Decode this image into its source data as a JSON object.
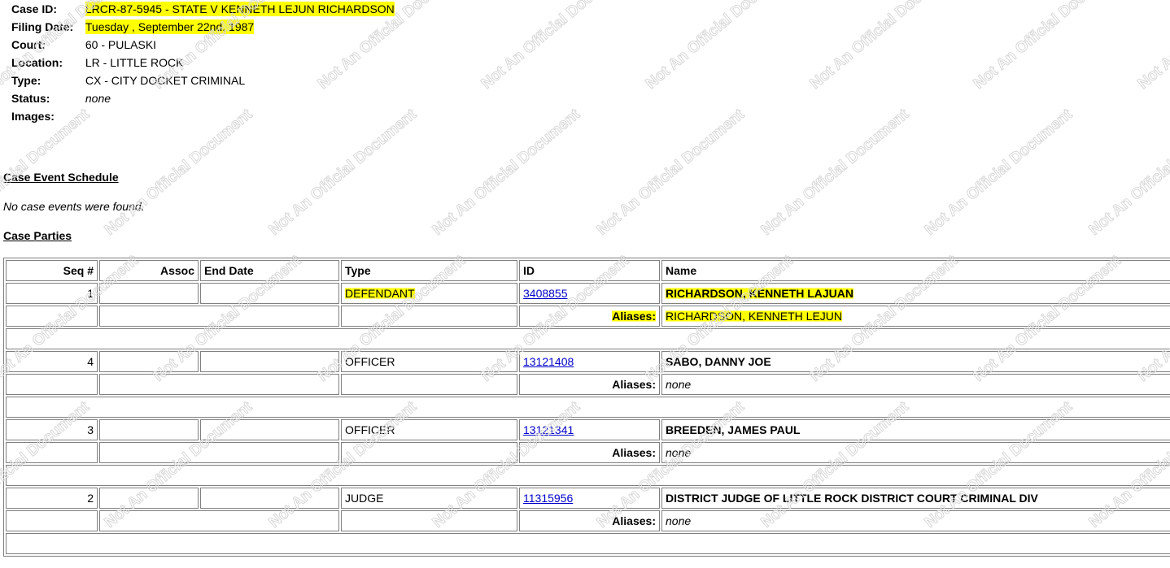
{
  "case": {
    "case_id_label": "Case ID:",
    "case_id_value": "LRCR-87-5945 - STATE V KENNETH LEJUN RICHARDSON",
    "filing_date_label": "Filing Date:",
    "filing_date_value": "Tuesday , September 22nd, 1987",
    "court_label": "Court:",
    "court_value": "60 - PULASKI",
    "location_label": "Location:",
    "location_value": "LR - LITTLE ROCK",
    "type_label": "Type:",
    "type_value": "CX - CITY DOCKET CRIMINAL",
    "status_label": "Status:",
    "status_value": "none",
    "images_label": "Images:"
  },
  "events": {
    "title": "Case Event Schedule",
    "empty_text": "No case events were found."
  },
  "parties": {
    "title": "Case Parties",
    "headers": {
      "seq": "Seq #",
      "assoc": "Assoc",
      "end_date": "End Date",
      "type": "Type",
      "id": "ID",
      "name": "Name"
    },
    "aliases_label": "Aliases:",
    "rows": [
      {
        "seq": "1",
        "assoc": "",
        "end_date": "",
        "type": "DEFENDANT",
        "id": "3408855",
        "name": "RICHARDSON, KENNETH LAJUAN",
        "aliases": "RICHARDSON, KENNETH LEJUN"
      },
      {
        "seq": "4",
        "assoc": "",
        "end_date": "",
        "type": "OFFICER",
        "id": "13121408",
        "name": "SABO, DANNY JOE",
        "aliases": "none"
      },
      {
        "seq": "3",
        "assoc": "",
        "end_date": "",
        "type": "OFFICER",
        "id": "13121341",
        "name": "BREEDEN, JAMES PAUL",
        "aliases": "none"
      },
      {
        "seq": "2",
        "assoc": "",
        "end_date": "",
        "type": "JUDGE",
        "id": "11315956",
        "name": "DISTRICT JUDGE OF LITTLE ROCK DISTRICT COURT CRIMINAL DIV",
        "aliases": "none"
      }
    ]
  },
  "watermark": {
    "text": "Not An Official Document",
    "color": "#d8d8d8"
  },
  "colors": {
    "highlight": "#ffff00",
    "link": "#0000cc",
    "border": "#808080"
  }
}
